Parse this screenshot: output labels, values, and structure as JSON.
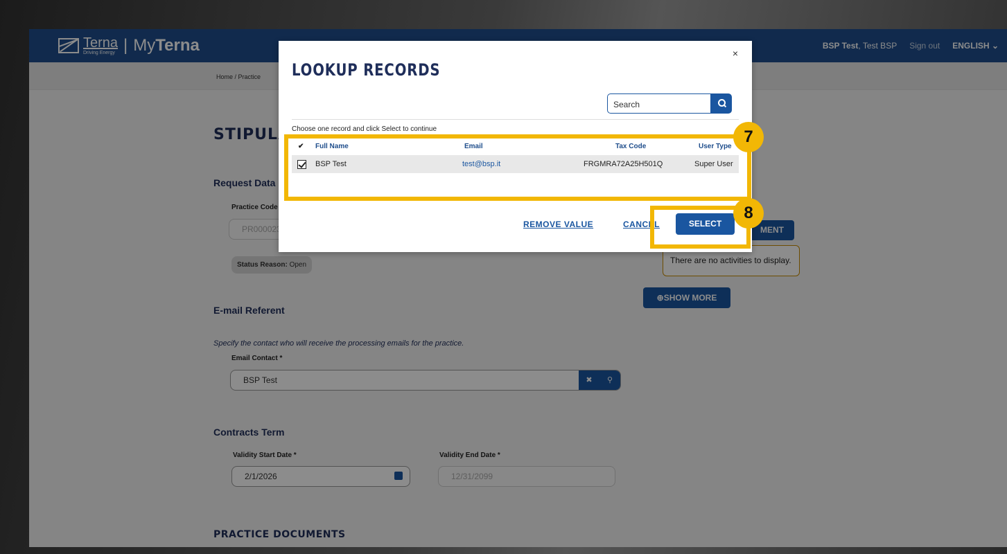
{
  "header": {
    "brand": "Terna",
    "brand_tagline": "Driving Energy",
    "separator": "|",
    "product_light": "My",
    "product_bold": "Terna",
    "user_bold": "BSP Test",
    "user_rest": ", Test BSP",
    "signout": "Sign out",
    "language": "ENGLISH",
    "language_chevron": "⌄"
  },
  "breadcrumb": "Home  /  Practice",
  "page": {
    "title": "STIPULAT",
    "request_data": "Request Data",
    "practice_code_label": "Practice Code",
    "practice_code_value": "PR000023",
    "status_reason_label": "Status Reason:",
    "status_reason_value": "Open",
    "email_referent_title": "E-mail Referent",
    "email_note": "Specify the contact who will receive the processing emails for the practice.",
    "email_contact_label": "Email Contact *",
    "email_contact_value": "BSP Test",
    "contracts_term_title": "Contracts Term",
    "validity_start_label": "Validity Start Date *",
    "validity_start_value": "2/1/2026",
    "validity_end_label": "Validity End Date *",
    "validity_end_value": "12/31/2099",
    "practice_documents": "PRACTICE DOCUMENTS",
    "attachment_button": "MENT",
    "no_activities": "There are no activities to display.",
    "show_more": "SHOW MORE"
  },
  "modal": {
    "title": "LOOKUP RECORDS",
    "close": "×",
    "search_placeholder": "Search",
    "instruction": "Choose one record and click Select to continue",
    "columns": {
      "check": "✔",
      "full_name": "Full Name",
      "email": "Email",
      "tax_code": "Tax Code",
      "user_type": "User Type"
    },
    "rows": [
      {
        "full_name": "BSP Test",
        "email": "test@bsp.it",
        "tax_code": "FRGMRA72A25H501Q",
        "user_type": "Super User"
      }
    ],
    "remove_value": "REMOVE VALUE",
    "cancel": "CANCEL",
    "select": "SELECT"
  },
  "markers": {
    "step7": "7",
    "step8": "8"
  },
  "colors": {
    "header": "#1f4e8c",
    "primary": "#1a56a0",
    "highlight": "#f2b705",
    "title": "#1f2e5a"
  },
  "icons": [
    "logo-icon",
    "search-icon",
    "close-icon",
    "calendar-icon",
    "clear-icon",
    "plus-circle-icon",
    "checkbox-icon",
    "chevron-down-icon"
  ]
}
